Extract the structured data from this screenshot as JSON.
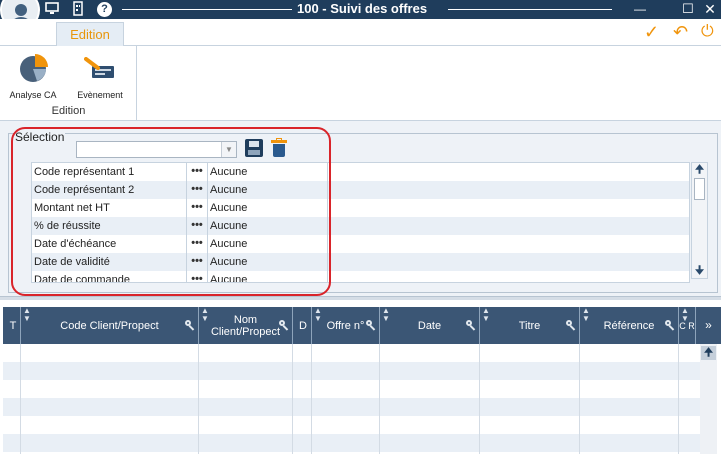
{
  "window": {
    "title": "100 - Suivi des offres",
    "help_label": "?",
    "minimize_glyph": "—",
    "maximize_glyph": "☐",
    "close_glyph": "✕"
  },
  "tabs": [
    {
      "label": "Edition",
      "active": true
    }
  ],
  "actions": {
    "validate_glyph": "✓",
    "undo_glyph": "↶",
    "power_glyph": "⏻"
  },
  "ribbon": {
    "group_label": "Edition",
    "buttons": [
      {
        "label": "Analyse CA",
        "icon": "pie-chart-icon"
      },
      {
        "label": "Evènement",
        "icon": "event-card-icon"
      }
    ]
  },
  "selection": {
    "legend": "Sélection",
    "combo_value": "",
    "criteria": [
      {
        "name": "Code représentant 1",
        "dots": "•••",
        "value": "Aucune"
      },
      {
        "name": "Code représentant 2",
        "dots": "•••",
        "value": "Aucune"
      },
      {
        "name": "Montant net HT",
        "dots": "•••",
        "value": "Aucune"
      },
      {
        "name": "% de réussite",
        "dots": "•••",
        "value": "Aucune"
      },
      {
        "name": "Date d'échéance",
        "dots": "•••",
        "value": "Aucune"
      },
      {
        "name": "Date de validité",
        "dots": "•••",
        "value": "Aucune"
      },
      {
        "name": "Date de commande",
        "dots": "•••",
        "value": "Aucune"
      }
    ]
  },
  "grid": {
    "columns": [
      {
        "label": "T",
        "sort": false,
        "key": false
      },
      {
        "label": "Code Client/Propect",
        "sort": true,
        "key": true
      },
      {
        "label": "Nom Client/Propect",
        "sort": true,
        "key": true
      },
      {
        "label": "D",
        "sort": false,
        "key": false
      },
      {
        "label": "Offre n°",
        "sort": true,
        "key": true
      },
      {
        "label": "Date",
        "sort": true,
        "key": true
      },
      {
        "label": "Titre",
        "sort": true,
        "key": true
      },
      {
        "label": "Référence",
        "sort": true,
        "key": true
      },
      {
        "label": "C R",
        "sort": true,
        "key": false
      }
    ],
    "row_count": 6
  },
  "colors": {
    "titlebar": "#1f3d5c",
    "accent": "#f0940c",
    "header": "#3b5675",
    "highlight": "#d9242a"
  }
}
